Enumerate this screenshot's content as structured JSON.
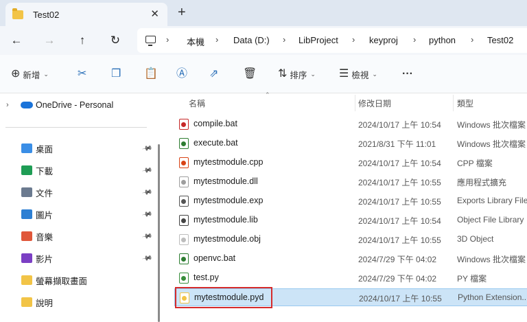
{
  "tab": {
    "title": "Test02",
    "close": "✕",
    "new": "+"
  },
  "nav": {
    "back": "←",
    "forward": "→",
    "up": "↑",
    "refresh": "↻"
  },
  "breadcrumb": [
    "本機",
    "Data (D:)",
    "LibProject",
    "keyproj",
    "python",
    "Test02"
  ],
  "breadcrumb_sep": "›",
  "toolbar": {
    "new_label": "新增",
    "sort_label": "排序",
    "view_label": "檢視",
    "more": "···"
  },
  "sidebar": {
    "onedrive": "OneDrive - Personal",
    "items": [
      {
        "label": "桌面",
        "icon": "desktop-icon",
        "color": "#3a8ee6",
        "pinned": true
      },
      {
        "label": "下載",
        "icon": "download-icon",
        "color": "#1f9d55",
        "pinned": true
      },
      {
        "label": "文件",
        "icon": "document-icon",
        "color": "#6b7a8f",
        "pinned": true
      },
      {
        "label": "圖片",
        "icon": "pictures-icon",
        "color": "#2d7fd3",
        "pinned": true
      },
      {
        "label": "音樂",
        "icon": "music-icon",
        "color": "#e0573a",
        "pinned": true
      },
      {
        "label": "影片",
        "icon": "video-icon",
        "color": "#7b3fc4",
        "pinned": true
      },
      {
        "label": "螢幕擷取畫面",
        "icon": "folder-icon",
        "color": "#f2c447",
        "pinned": false
      },
      {
        "label": "說明",
        "icon": "folder-icon",
        "color": "#f2c447",
        "pinned": false
      }
    ]
  },
  "columns": {
    "name": "名稱",
    "modified": "修改日期",
    "type": "類型"
  },
  "files": [
    {
      "name": "compile.bat",
      "date": "2024/10/17 上午 10:54",
      "type": "Windows 批次檔案",
      "icon": "batch-icon",
      "color": "#c62828"
    },
    {
      "name": "execute.bat",
      "date": "2021/8/31 下午 11:01",
      "type": "Windows 批次檔案",
      "icon": "batch-icon",
      "color": "#2e7d32"
    },
    {
      "name": "mytestmodule.cpp",
      "date": "2024/10/17 上午 10:54",
      "type": "CPP 檔案",
      "icon": "cpp-file-icon",
      "color": "#d84315"
    },
    {
      "name": "mytestmodule.dll",
      "date": "2024/10/17 上午 10:55",
      "type": "應用程式擴充",
      "icon": "dll-file-icon",
      "color": "#9e9e9e"
    },
    {
      "name": "mytestmodule.exp",
      "date": "2024/10/17 上午 10:55",
      "type": "Exports Library File",
      "icon": "exp-file-icon",
      "color": "#555555"
    },
    {
      "name": "mytestmodule.lib",
      "date": "2024/10/17 上午 10:54",
      "type": "Object File Library",
      "icon": "lib-file-icon",
      "color": "#444444"
    },
    {
      "name": "mytestmodule.obj",
      "date": "2024/10/17 上午 10:55",
      "type": "3D Object",
      "icon": "obj-file-icon",
      "color": "#bdbdbd"
    },
    {
      "name": "openvc.bat",
      "date": "2024/7/29 下午 04:02",
      "type": "Windows 批次檔案",
      "icon": "batch-icon",
      "color": "#2e7d32"
    },
    {
      "name": "test.py",
      "date": "2024/7/29 下午 04:02",
      "type": "PY 檔案",
      "icon": "python-file-icon",
      "color": "#388e3c"
    },
    {
      "name": "mytestmodule.pyd",
      "date": "2024/10/17 上午 10:55",
      "type": "Python Extension...",
      "icon": "pyd-file-icon",
      "color": "#f2c447"
    }
  ],
  "selected_file_index": 9
}
